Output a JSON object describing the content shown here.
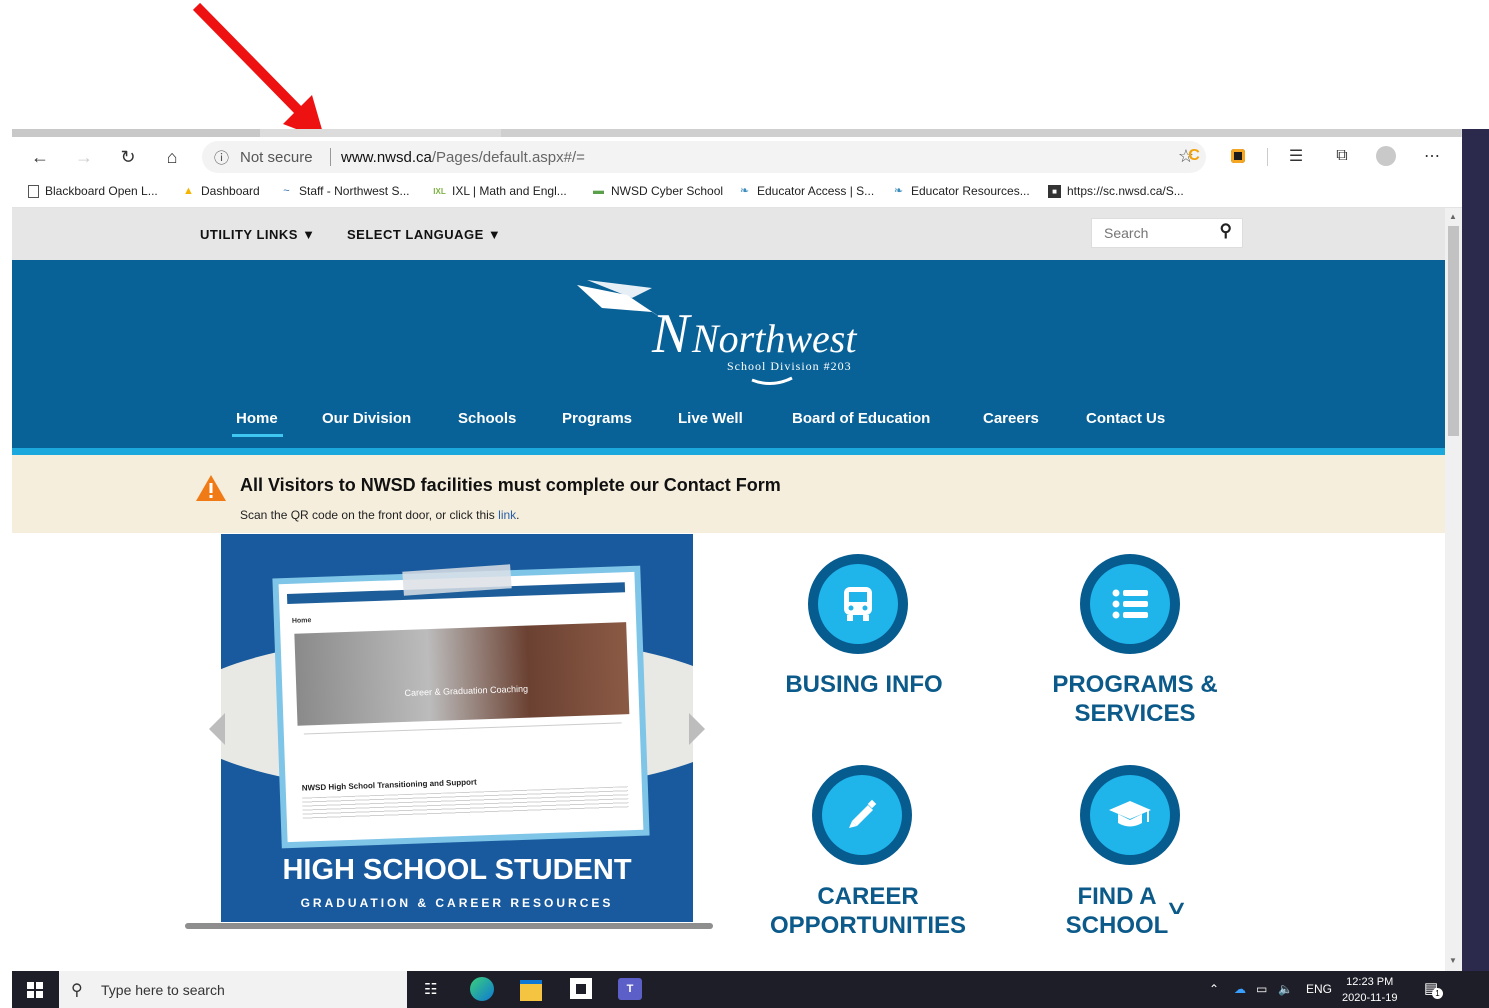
{
  "browser": {
    "address": {
      "security_label": "Not secure",
      "host": "www.nwsd.ca",
      "path": "/Pages/default.aspx#/="
    },
    "favorites": [
      {
        "label": "Blackboard Open L...",
        "icon": "page-icon"
      },
      {
        "label": "Dashboard",
        "icon": "dashboard-icon"
      },
      {
        "label": "Staff - Northwest S...",
        "icon": "nwsd-icon"
      },
      {
        "label": "IXL | Math and Engl...",
        "icon": "ixl-icon"
      },
      {
        "label": "NWSD Cyber School",
        "icon": "cyber-icon"
      },
      {
        "label": "Educator Access | S...",
        "icon": "leaf-icon"
      },
      {
        "label": "Educator Resources...",
        "icon": "leaf-icon"
      },
      {
        "label": "https://sc.nwsd.ca/S...",
        "icon": "sc-icon"
      }
    ]
  },
  "utility": {
    "links_label": "UTILITY LINKS",
    "language_label": "SELECT LANGUAGE",
    "search_placeholder": "Search"
  },
  "logo": {
    "name": "Northwest",
    "sub": "School Division #203"
  },
  "nav": [
    "Home",
    "Our Division",
    "Schools",
    "Programs",
    "Live Well",
    "Board of Education",
    "Careers",
    "Contact Us"
  ],
  "alert": {
    "title": "All Visitors to NWSD facilities must complete our Contact Form",
    "subtitle": "Scan the QR code on the front door, or click this",
    "link_text": "link",
    "period": "."
  },
  "slide": {
    "title": "HIGH SCHOOL STUDENT",
    "subtitle": "GRADUATION & CAREER RESOURCES",
    "card_home": "Home",
    "card_photo_caption": "Career & Graduation Coaching",
    "card_heading": "NWSD High School Transitioning and Support"
  },
  "quick_links": [
    {
      "label_line1": "BUSING INFO",
      "label_line2": "",
      "icon": "bus-icon"
    },
    {
      "label_line1": "PROGRAMS &",
      "label_line2": "SERVICES",
      "icon": "list-icon"
    },
    {
      "label_line1": "CAREER",
      "label_line2": "OPPORTUNITIES",
      "icon": "pencil-icon"
    },
    {
      "label_line1": "FIND A",
      "label_line2": "SCHOOL",
      "icon": "graduation-cap-icon"
    }
  ],
  "taskbar": {
    "search_placeholder": "Type here to search",
    "language": "ENG",
    "time": "12:23 PM",
    "date": "2020-11-19",
    "notification_count": "1"
  },
  "colors": {
    "header_blue": "#086197",
    "accent_cyan": "#1fb4ea",
    "alert_bg": "#f5eedd",
    "annotation_red": "#ee1111"
  }
}
